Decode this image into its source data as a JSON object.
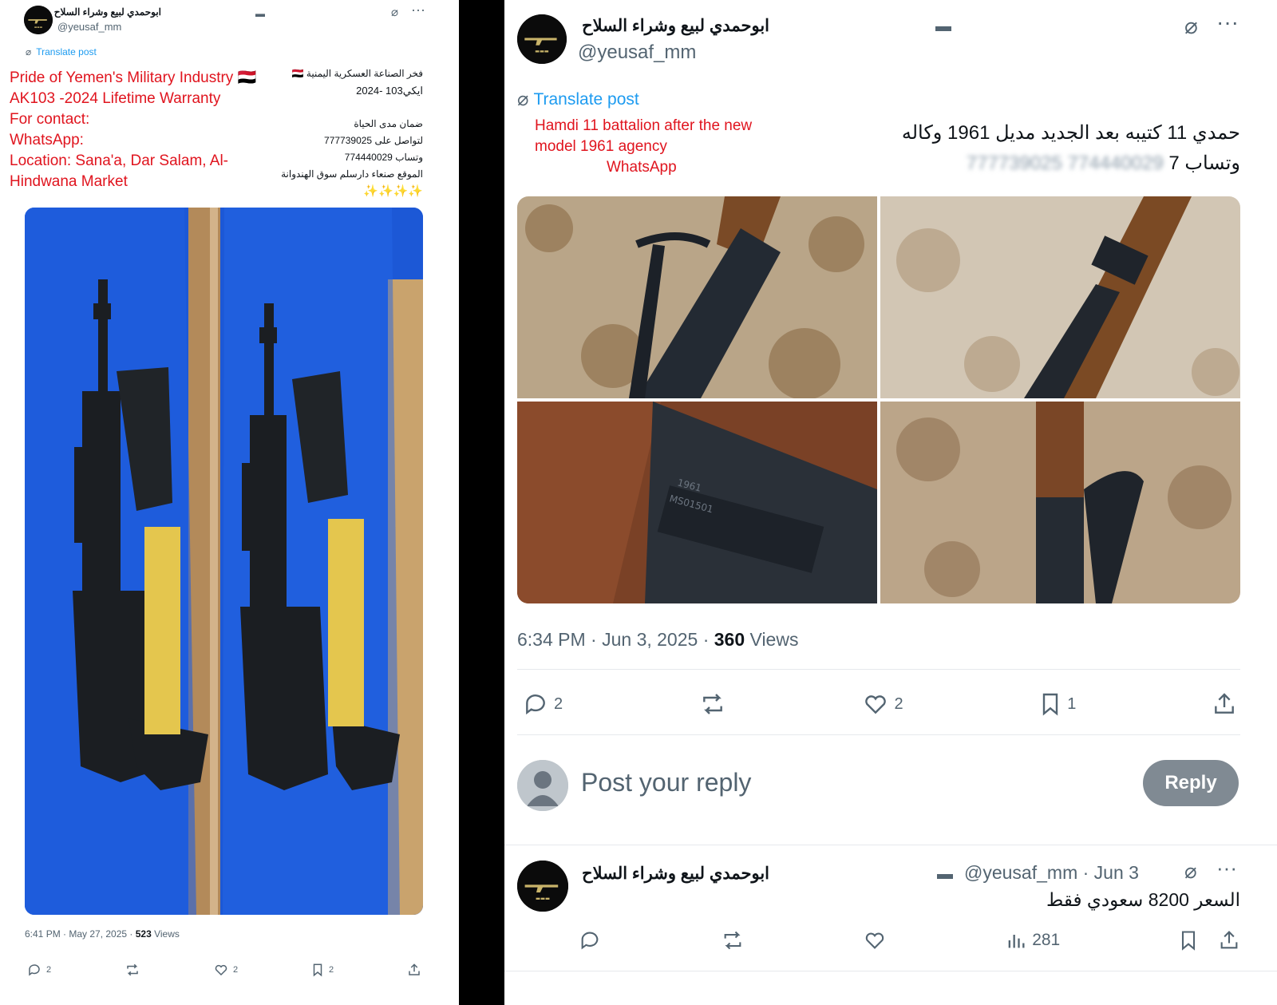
{
  "left_post": {
    "name": "ابوحمدي لبيع وشراء السلاح",
    "handle": "@yeusaf_mm",
    "translate_label": "Translate post",
    "translation_lines": [
      "Pride of Yemen's Military Industry 🇾🇪",
      "AK103 -2024 Lifetime Warranty",
      "For contact:",
      "WhatsApp:",
      "Location: Sana'a, Dar Salam, Al-",
      "Hindwana Market"
    ],
    "arabic_lines": [
      "فخر الصناعة العسكرية اليمنية 🇾🇪",
      "ايكي103 -2024",
      "ضمان مدى الحياة",
      "لتواصل على 777739025",
      "وتساب 774440029",
      "الموقع صنعاء دارسلم سوق الهندوانة",
      "✨✨✨✨"
    ],
    "timestamp": "6:41 PM · May 27, 2025 · ",
    "views_count": "523",
    "views_label": " Views",
    "replies": "2",
    "likes": "2",
    "bookmarks": "2"
  },
  "right_post": {
    "name": "ابوحمدي لبيع وشراء السلاح",
    "handle": "@yeusaf_mm",
    "translate_label": "Translate post",
    "translation_lines": [
      "Hamdi 11 battalion after the new",
      "model 1961 agency",
      "WhatsApp"
    ],
    "arabic_line1": "حمدي 11 كتيبه بعد الجديد مديل 1961 وكاله",
    "arabic_line2_prefix": "وتساب 7",
    "arabic_line2_blurred": "774440029 777739025",
    "timestamp": "6:34 PM · Jun 3, 2025 · ",
    "views_count": "360",
    "views_label": " Views",
    "replies": "2",
    "likes": "2",
    "bookmarks": "1",
    "reply_placeholder": "Post your reply",
    "reply_button": "Reply"
  },
  "reply_post": {
    "name": "ابوحمدي لبيع وشراء السلاح",
    "handle_date": "@yeusaf_mm · Jun 3",
    "text": "السعر 8200 سعودي فقط",
    "views": "281"
  },
  "colors": {
    "link": "#1d9bf0",
    "translation_red": "#e0141e",
    "muted": "#536471"
  }
}
